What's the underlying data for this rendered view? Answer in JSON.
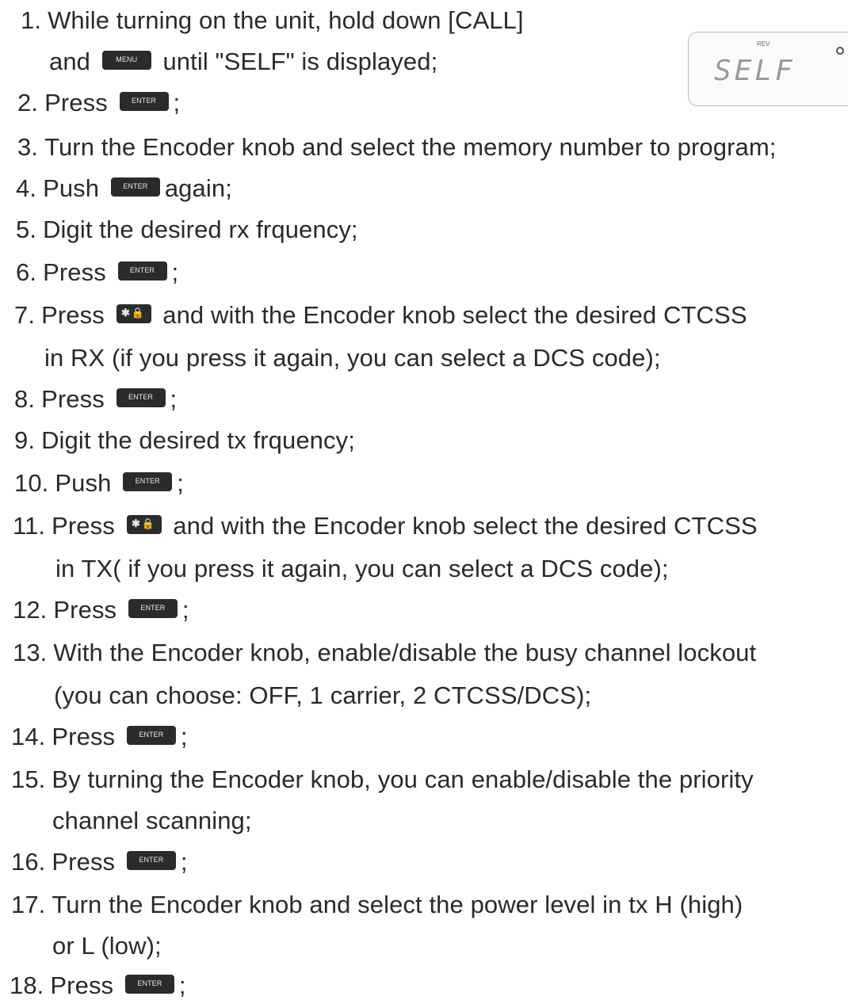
{
  "display": {
    "rev_label": "REV",
    "text": "SELF"
  },
  "keys": {
    "menu": "MENU",
    "enter": "ENTER",
    "star": "✱🔒"
  },
  "steps": [
    {
      "num": "1.",
      "text": "While turning on the unit, hold down [CALL]"
    },
    {
      "pre": "and",
      "post": "until \"SELF\" is displayed;"
    },
    {
      "num": "2.",
      "text": "Press",
      "post": ";"
    },
    {
      "num": "3.",
      "text": "Turn the Encoder knob and select the memory number to program;"
    },
    {
      "num": "4.",
      "text": "Push",
      "post": "again;"
    },
    {
      "num": "5.",
      "text": "Digit the desired rx frquency;"
    },
    {
      "num": "6.",
      "text": "Press",
      "post": ";"
    },
    {
      "num": "7.",
      "text": "Press",
      "post": "and with the Encoder knob select the desired CTCSS"
    },
    {
      "text": "in RX (if you press it again,  you can select a DCS code);"
    },
    {
      "num": "8.",
      "text": "Press",
      "post": ";"
    },
    {
      "num": "9.",
      "text": "Digit the desired tx frquency;"
    },
    {
      "num": "10.",
      "text": "Push",
      "post": ";"
    },
    {
      "num": "11.",
      "text": "Press",
      "post": "and with the Encoder knob select the desired CTCSS"
    },
    {
      "text": "in TX( if you press it again, you can select a DCS code);"
    },
    {
      "num": "12.",
      "text": "Press",
      "post": ";"
    },
    {
      "num": "13.",
      "text": "With the Encoder knob, enable/disable the busy channel lockout"
    },
    {
      "text": "(you can choose: OFF, 1 carrier, 2 CTCSS/DCS);"
    },
    {
      "num": "14.",
      "text": "Press",
      "post": ";"
    },
    {
      "num": "15.",
      "text": "By turning the Encoder knob, you can enable/disable the priority"
    },
    {
      "text": "channel scanning;"
    },
    {
      "num": "16.",
      "text": "Press",
      "post": ";"
    },
    {
      "num": "17.",
      "text": "Turn the Encoder knob and select the power level in tx H (high)"
    },
    {
      "text": "or L (low);"
    },
    {
      "num": "18.",
      "text": "Press",
      "post": ";"
    }
  ]
}
